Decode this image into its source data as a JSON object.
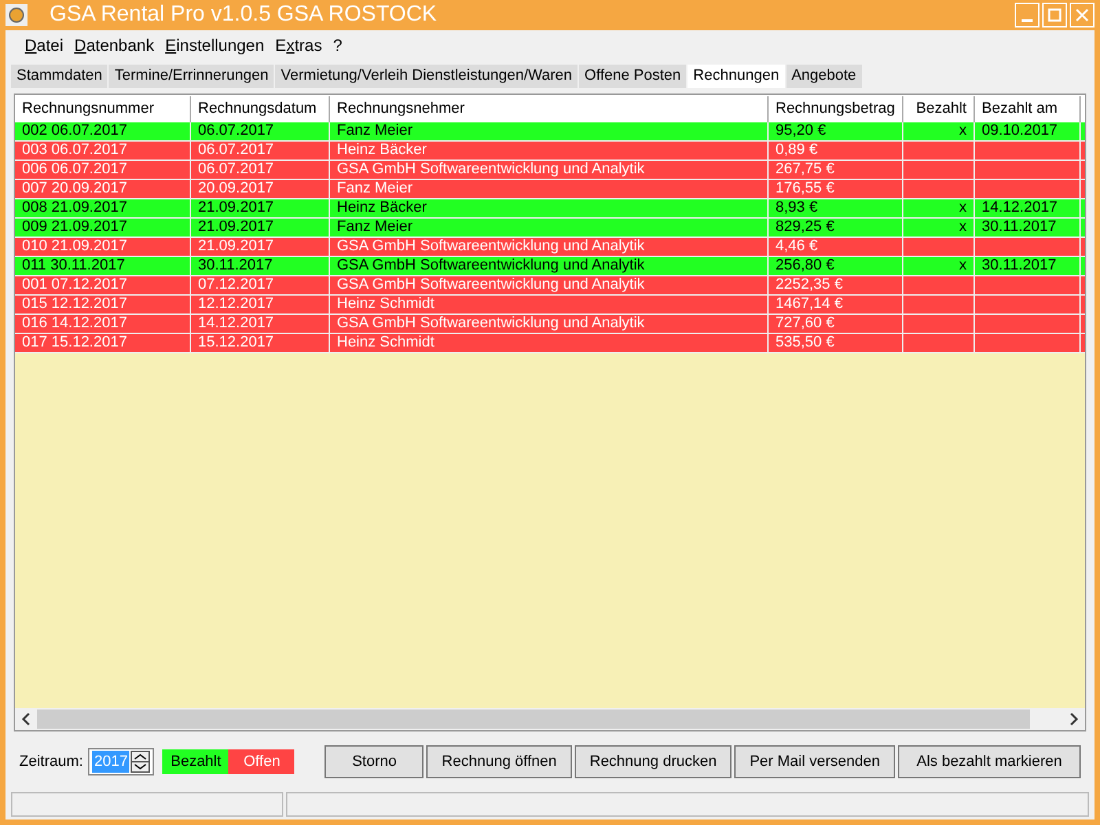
{
  "window": {
    "title": "GSA Rental Pro v1.0.5  GSA ROSTOCK"
  },
  "menu": [
    {
      "accel": "D",
      "after": "atei"
    },
    {
      "accel": "D",
      "after": "atenbank"
    },
    {
      "accel": "E",
      "after": "instellungen"
    },
    {
      "before": "E",
      "accel": "x",
      "after": "tras"
    },
    {
      "before": "?"
    }
  ],
  "tabs": [
    {
      "label": "Stammdaten",
      "selected": false
    },
    {
      "label": "Termine/Errinnerungen",
      "selected": false
    },
    {
      "label": "Vermietung/Verleih Dienstleistungen/Waren",
      "selected": false
    },
    {
      "label": "Offene Posten",
      "selected": false
    },
    {
      "label": "Rechnungen",
      "selected": true
    },
    {
      "label": "Angebote",
      "selected": false
    }
  ],
  "table": {
    "columns": [
      "Rechnungsnummer",
      "Rechnungsdatum",
      "Rechnungsnehmer",
      "Rechnungsbetrag",
      "Bezahlt",
      "Bezahlt am"
    ],
    "rows": [
      {
        "kind": "paid",
        "cells": [
          "002 06.07.2017",
          "06.07.2017",
          "Fanz Meier",
          "95,20 €",
          "x",
          "09.10.2017"
        ]
      },
      {
        "kind": "open",
        "cells": [
          "003 06.07.2017",
          "06.07.2017",
          "Heinz Bäcker",
          "0,89 €",
          "",
          ""
        ]
      },
      {
        "kind": "open",
        "cells": [
          "006 06.07.2017",
          "06.07.2017",
          "GSA GmbH Softwareentwicklung und Analytik",
          "267,75 €",
          "",
          ""
        ]
      },
      {
        "kind": "open",
        "cells": [
          "007 20.09.2017",
          "20.09.2017",
          "Fanz Meier",
          "176,55 €",
          "",
          ""
        ]
      },
      {
        "kind": "paid",
        "cells": [
          "008 21.09.2017",
          "21.09.2017",
          "Heinz Bäcker",
          "8,93 €",
          "x",
          "14.12.2017"
        ]
      },
      {
        "kind": "paid",
        "cells": [
          "009 21.09.2017",
          "21.09.2017",
          "Fanz Meier",
          "829,25 €",
          "x",
          "30.11.2017"
        ]
      },
      {
        "kind": "open",
        "cells": [
          "010 21.09.2017",
          "21.09.2017",
          "GSA GmbH Softwareentwicklung und Analytik",
          "4,46 €",
          "",
          ""
        ]
      },
      {
        "kind": "paid",
        "cells": [
          "011 30.11.2017",
          "30.11.2017",
          "GSA GmbH Softwareentwicklung und Analytik",
          "256,80 €",
          "x",
          "30.11.2017"
        ]
      },
      {
        "kind": "open",
        "cells": [
          "001 07.12.2017",
          "07.12.2017",
          "GSA GmbH Softwareentwicklung und Analytik",
          "2252,35 €",
          "",
          ""
        ]
      },
      {
        "kind": "open",
        "cells": [
          "015 12.12.2017",
          "12.12.2017",
          "Heinz Schmidt",
          "1467,14 €",
          "",
          ""
        ]
      },
      {
        "kind": "open",
        "cells": [
          "016 14.12.2017",
          "14.12.2017",
          "GSA GmbH Softwareentwicklung und Analytik",
          "727,60 €",
          "",
          ""
        ]
      },
      {
        "kind": "open",
        "cells": [
          "017 15.12.2017",
          "15.12.2017",
          "Heinz Schmidt",
          "535,50 €",
          "",
          ""
        ]
      }
    ]
  },
  "footer": {
    "period_label": "Zeitraum:",
    "year": "2017",
    "legend": [
      {
        "kind": "paid",
        "label": "Bezahlt"
      },
      {
        "kind": "open",
        "label": "Offen"
      }
    ],
    "buttons": [
      "Storno",
      "Rechnung öffnen",
      "Rechnung drucken",
      "Per Mail versenden",
      "Als bezahlt markieren"
    ]
  }
}
